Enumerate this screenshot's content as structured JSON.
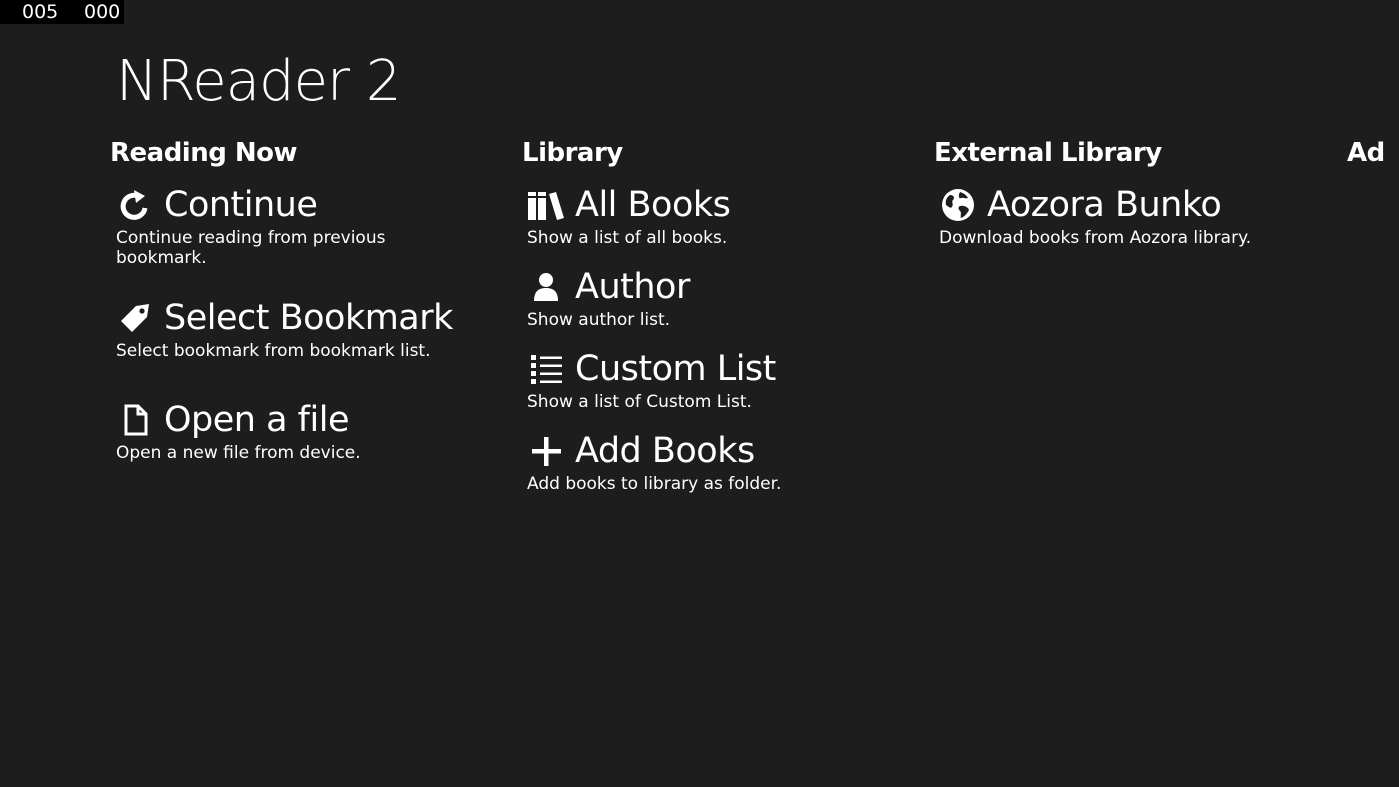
{
  "status": {
    "counter_left": "005",
    "counter_right": "000"
  },
  "app": {
    "title": "NReader 2"
  },
  "groups": {
    "reading_now": {
      "header": "Reading Now",
      "items": [
        {
          "title": "Continue",
          "description": "Continue reading from previous bookmark.",
          "icon": "continue-arrow-icon"
        },
        {
          "title": "Select Bookmark",
          "description": "Select bookmark from bookmark list.",
          "icon": "tag-icon"
        },
        {
          "title": "Open a file",
          "description": "Open a new file from device.",
          "icon": "file-icon"
        }
      ]
    },
    "library": {
      "header": "Library",
      "items": [
        {
          "title": "All Books",
          "description": "Show a list of all books.",
          "icon": "books-icon"
        },
        {
          "title": "Author",
          "description": "Show author list.",
          "icon": "person-icon"
        },
        {
          "title": "Custom List",
          "description": "Show a list of Custom List.",
          "icon": "list-icon"
        },
        {
          "title": "Add Books",
          "description": "Add books to library as folder.",
          "icon": "plus-icon"
        }
      ]
    },
    "external_library": {
      "header": "External Library",
      "items": [
        {
          "title": "Aozora Bunko",
          "description": "Download books from Aozora library.",
          "icon": "globe-icon"
        }
      ]
    },
    "ad": {
      "header": "Ad"
    }
  },
  "colors": {
    "background": "#1d1d1d",
    "text": "#ffffff",
    "counter_background": "#000000"
  }
}
